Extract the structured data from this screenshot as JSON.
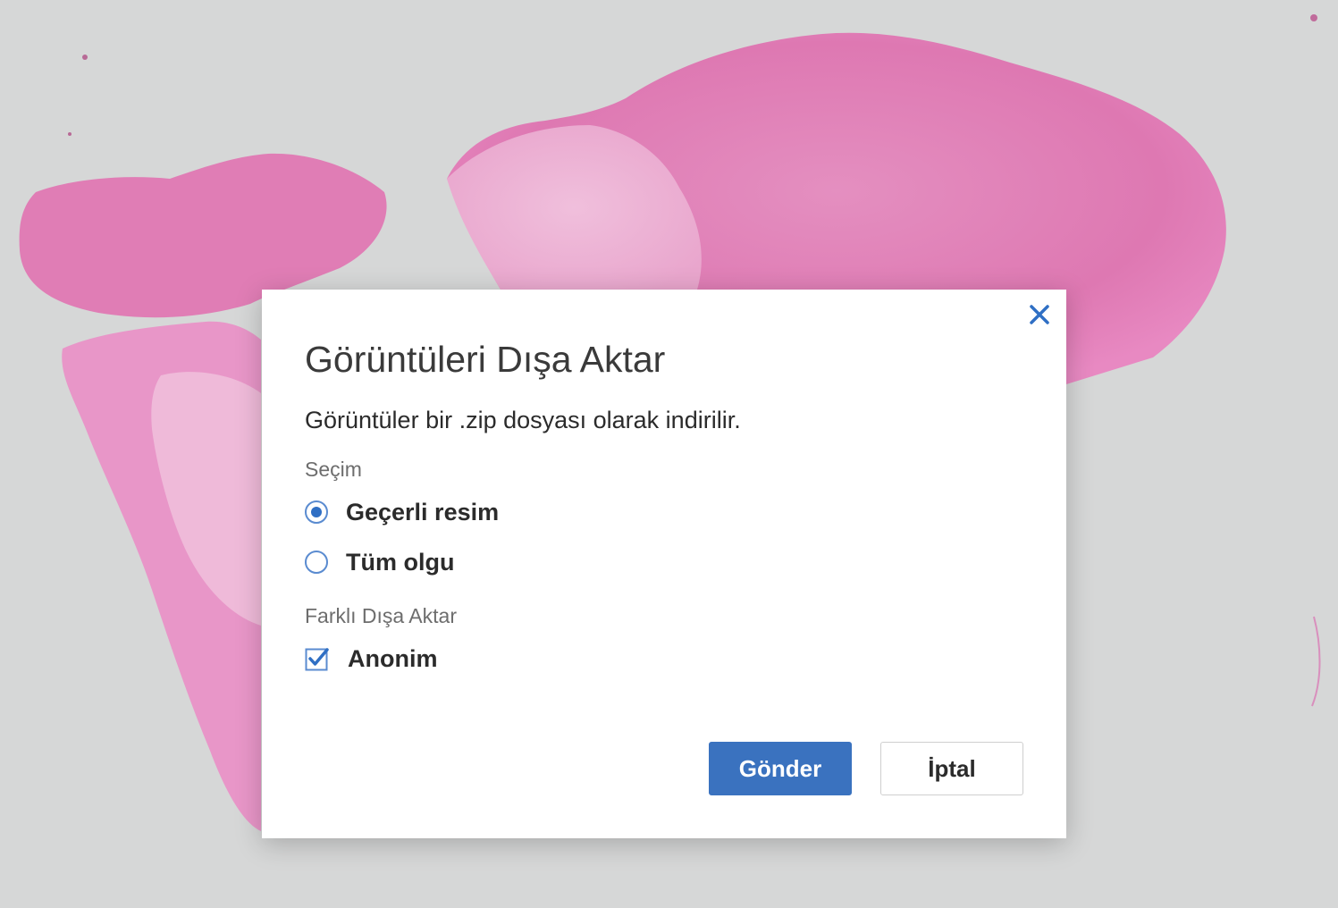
{
  "dialog": {
    "title": "Görüntüleri Dışa Aktar",
    "description": "Görüntüler bir .zip dosyası olarak indirilir.",
    "close_icon": "close-icon",
    "selection": {
      "label": "Seçim",
      "options": [
        {
          "label": "Geçerli resim",
          "selected": true
        },
        {
          "label": "Tüm olgu",
          "selected": false
        }
      ]
    },
    "export_as": {
      "label": "Farklı Dışa Aktar",
      "anonymous": {
        "label": "Anonim",
        "checked": true
      }
    },
    "buttons": {
      "submit": "Gönder",
      "cancel": "İptal"
    }
  },
  "colors": {
    "accent": "#3a72bf",
    "background": "#d6d7d7",
    "tissue": "#e07fb4"
  }
}
